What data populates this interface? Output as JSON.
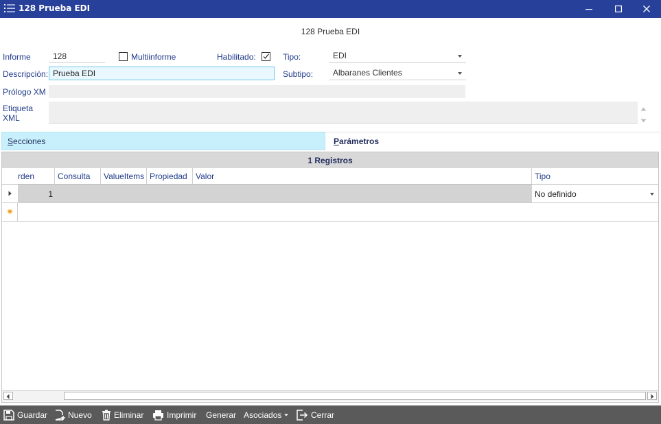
{
  "window": {
    "title": "128 Prueba EDI",
    "controls": [
      "minimize",
      "maximize",
      "close"
    ]
  },
  "form": {
    "heading": "128 Prueba EDI",
    "informe_label": "Informe",
    "informe_value": "128",
    "multiinforme_label": "Multiinforme",
    "multiinforme_checked": false,
    "habilitado_label": "Habilitado:",
    "habilitado_checked": true,
    "tipo_label": "Tipo:",
    "tipo_value": "EDI",
    "descripcion_label": "Descripción:",
    "descripcion_value": "Prueba EDI",
    "subtipo_label": "Subtipo:",
    "subtipo_value": "Albaranes Clientes",
    "prologo_label": "Prólogo XM",
    "prologo_value": "",
    "etiqueta_label_1": "Etiqueta",
    "etiqueta_label_2": "XML",
    "etiqueta_value": ""
  },
  "tabs": {
    "secciones": "Secciones",
    "parametros": "Parámetros",
    "active": "parametros"
  },
  "grid": {
    "title": "1 Registros",
    "columns": [
      "rden",
      "Consulta",
      "ValueItems",
      "Propiedad",
      "Valor",
      "Tipo"
    ],
    "rows": [
      {
        "orden": "1",
        "consulta": "",
        "valueitems": "",
        "propiedad": "",
        "valor": "",
        "tipo": "No definido"
      }
    ],
    "new_row_marker": "✷"
  },
  "toolbar": {
    "guardar": "Guardar",
    "nuevo": "Nuevo",
    "eliminar": "Eliminar",
    "imprimir": "Imprimir",
    "generar": "Generar",
    "asociados": "Asociados",
    "cerrar": "Cerrar"
  },
  "colors": {
    "titlebar": "#27409a",
    "label_text": "#1f3a8a",
    "active_input_border": "#6fc7e6",
    "active_tab": "#c8f0fc",
    "toolbar_bg": "#5a5a5a",
    "new_row_marker": "#f0a020"
  }
}
